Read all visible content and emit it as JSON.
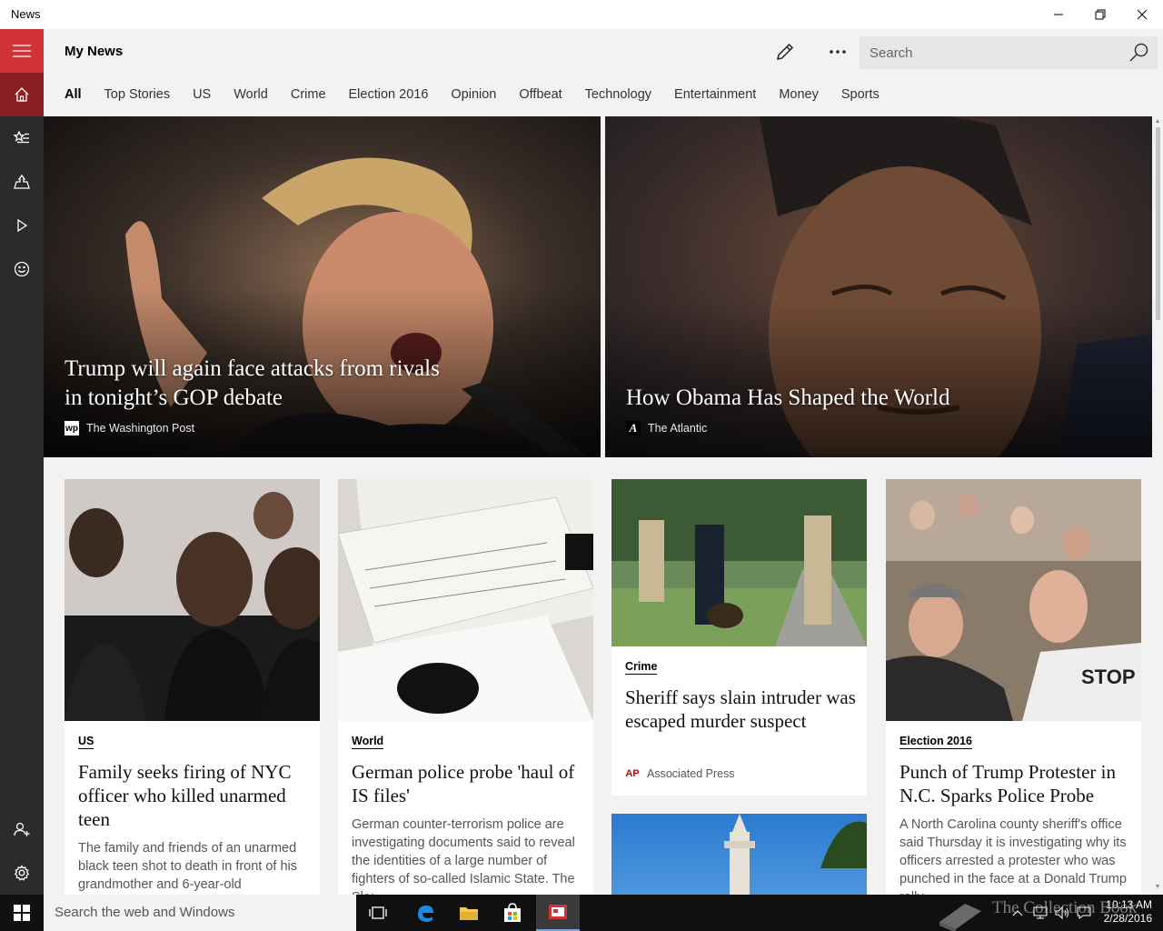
{
  "window": {
    "title": "News"
  },
  "header": {
    "title": "My News",
    "search_placeholder": "Search"
  },
  "tabs": [
    "All",
    "Top Stories",
    "US",
    "World",
    "Crime",
    "Election 2016",
    "Opinion",
    "Offbeat",
    "Technology",
    "Entertainment",
    "Money",
    "Sports"
  ],
  "active_tab": "All",
  "hero_stories": [
    {
      "headline": "Trump will again face attacks from rivals in tonight’s GOP debate",
      "source": "The Washington Post",
      "source_logo": "wp"
    },
    {
      "headline": "How Obama Has Shaped the World",
      "source": "The Atlantic",
      "source_logo": "A"
    }
  ],
  "cards": [
    {
      "category": "US",
      "title": "Family seeks firing of NYC officer who killed unarmed teen",
      "summary": "The family and friends of an unarmed black teen shot to death in front of his grandmother and 6-year-old"
    },
    {
      "category": "World",
      "title": "German police probe 'haul of IS files'",
      "summary": "German counter-terrorism police are investigating documents said to reveal the identities of a large number of fighters of so-called Islamic State. The Sky..."
    },
    {
      "category": "Crime",
      "title": "Sheriff says slain intruder was escaped murder suspect",
      "source": "Associated Press",
      "source_logo": "AP"
    },
    {
      "category": "Election 2016",
      "title": "Punch of Trump Protester in N.C. Sparks Police Probe",
      "summary": "A North Carolina county sheriff's office said Thursday it is investigating why its officers arrested a protester who was punched in the face at a Donald Trump rally..."
    }
  ],
  "taskbar": {
    "search_placeholder": "Search the web and Windows",
    "time": "10:13 AM",
    "date": "2/28/2016"
  },
  "watermark": "The Collection Book",
  "colors": {
    "accent": "#d13438",
    "rail": "#2b2b2b",
    "rail_active": "#8a1f22",
    "taskbar": "#101010"
  }
}
